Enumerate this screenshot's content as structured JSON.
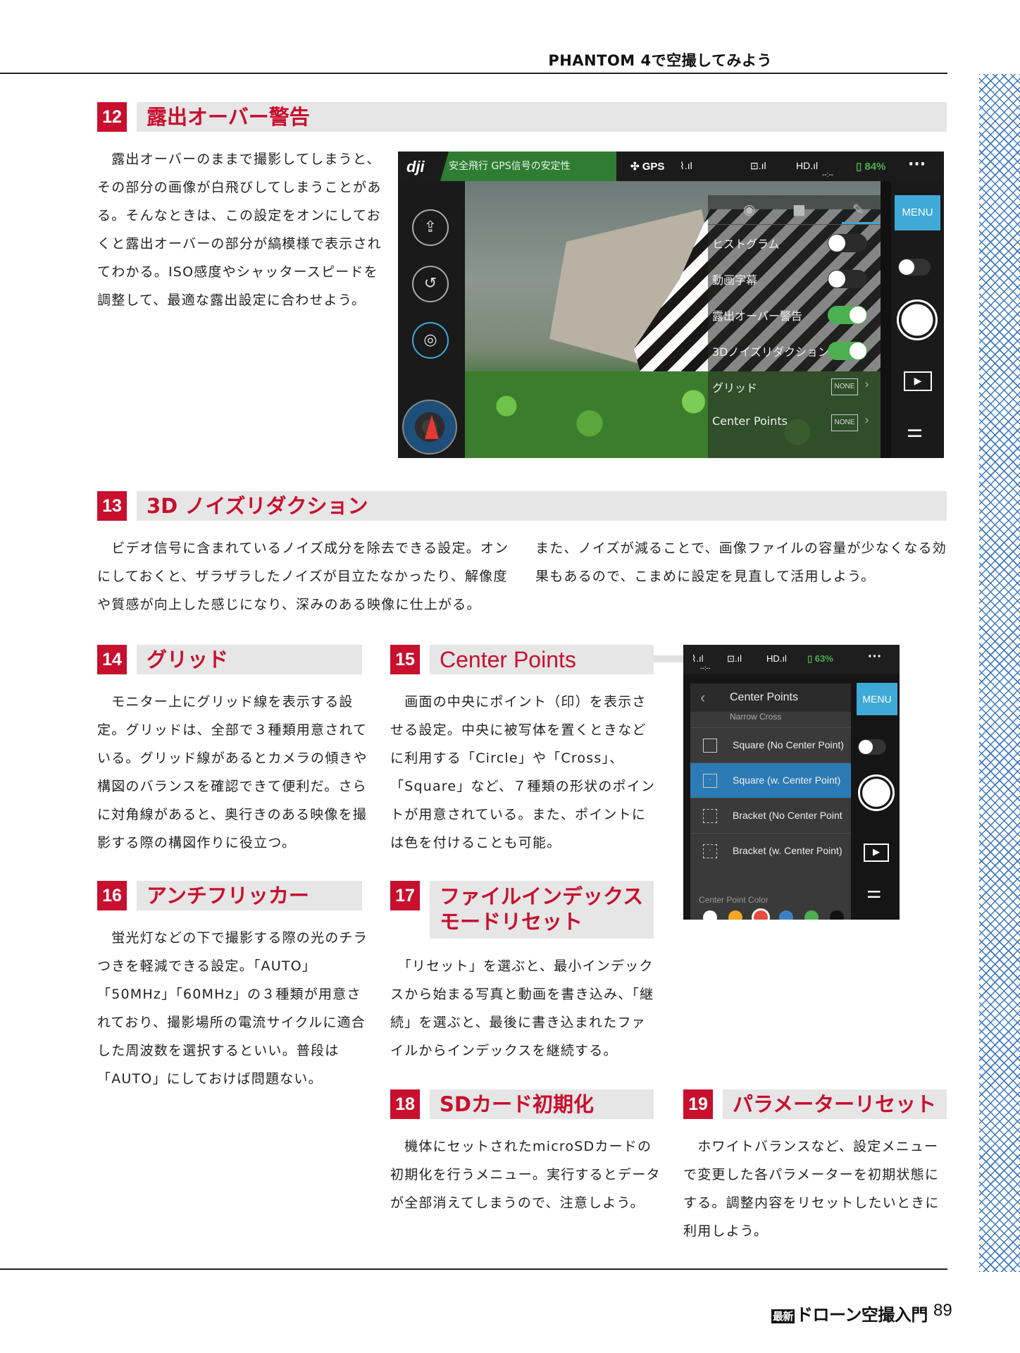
{
  "header": {
    "running_title": "PHANTOM 4で空撮してみよう"
  },
  "sections": [
    {
      "num": "12",
      "title": "露出オーバー警告",
      "body": "　露出オーバーのままで撮影してしまうと、その部分の画像が白飛びしてしまうことがある。そんなときは、この設定をオンにしておくと露出オーバーの部分が縞模様で表示されてわかる。ISO感度やシャッタースピードを調整して、最適な露出設定に合わせよう。"
    },
    {
      "num": "13",
      "title": "3D ノイズリダクション",
      "body_left": "　ビデオ信号に含まれているノイズ成分を除去できる設定。オンにしておくと、ザラザラしたノイズが目立たなかったり、解像度や質感が向上した感じになり、深みのある映像に仕上がる。",
      "body_right": "また、ノイズが減ることで、画像ファイルの容量が少なくなる効果もあるので、こまめに設定を見直して活用しよう。"
    },
    {
      "num": "14",
      "title": "グリッド",
      "body": "　モニター上にグリッド線を表示する設定。グリッドは、全部で３種類用意されている。グリッド線があるとカメラの傾きや構図のバランスを確認できて便利だ。さらに対角線があると、奥行きのある映像を撮影する際の構図作りに役立つ。"
    },
    {
      "num": "15",
      "title": "Center Points",
      "body": "　画面の中央にポイント（印）を表示させる設定。中央に被写体を置くときなどに利用する「Circle」や「Cross」、「Square」など、７種類の形状のポイントが用意されている。また、ポイントには色を付けることも可能。"
    },
    {
      "num": "16",
      "title": "アンチフリッカー",
      "body": "　蛍光灯などの下で撮影する際の光のチラつきを軽減できる設定。「AUTO」「50MHz」「60MHz」の３種類が用意されており、撮影場所の電流サイクルに適合した周波数を選択するといい。普段は「AUTO」にしておけば問題ない。"
    },
    {
      "num": "17",
      "title_line1": "ファイルインデックス",
      "title_line2": "モードリセット",
      "body": "　「リセット」を選ぶと、最小インデックスから始まる写真と動画を書き込み、「継続」を選ぶと、最後に書き込まれたファイルからインデックスを継続する。"
    },
    {
      "num": "18",
      "title": "SDカード初期化",
      "body": "　機体にセットされたmicroSDカードの初期化を行うメニュー。実行するとデータが全部消えてしまうので、注意しよう。"
    },
    {
      "num": "19",
      "title": "パラメーターリセット",
      "body": "　ホワイトバランスなど、設定メニューで変更した各パラメーターを初期状態にする。調整内容をリセットしたいときに利用しよう。"
    }
  ],
  "screenshot1": {
    "logo": "dji",
    "status_text": "安全飛行 GPS信号の安定性",
    "gps_label": "GPS",
    "hd_label": "HD.ıl",
    "battery": "84%",
    "timer": "--:--",
    "menu_label": "MENU",
    "rows": [
      {
        "label": "ヒストグラム",
        "type": "toggle",
        "on": false
      },
      {
        "label": "動画字幕",
        "type": "toggle",
        "on": false
      },
      {
        "label": "露出オーバー警告",
        "type": "toggle",
        "on": true
      },
      {
        "label": "3Dノイズリダクション",
        "type": "toggle",
        "on": true
      },
      {
        "label": "グリッド",
        "type": "value",
        "value": "NONE"
      },
      {
        "label": "Center Points",
        "type": "value",
        "value": "NONE"
      }
    ],
    "colors": {
      "menu": "#3fa9d8",
      "toggle_on": "#4caf50",
      "status_bar": "#2e7d32"
    }
  },
  "screenshot2": {
    "hd_label": "HD.ıl",
    "battery": "63%",
    "timer": "--:--",
    "menu_label": "MENU",
    "list_title": "Center Points",
    "cut_item": "Narrow Cross",
    "items": [
      {
        "label": "Square (No Center Point)",
        "selected": false,
        "icon": "square"
      },
      {
        "label": "Square (w. Center Point)",
        "selected": true,
        "icon": "square-dot"
      },
      {
        "label": "Bracket (No Center Point",
        "selected": false,
        "icon": "bracket"
      },
      {
        "label": "Bracket (w. Center Point)",
        "selected": false,
        "icon": "bracket-dot"
      }
    ],
    "color_label": "Center Point Color",
    "color_swatches": [
      "#ffffff",
      "#f5a623",
      "#e74c3c",
      "#3b82c4",
      "#4caf50",
      "#111111"
    ],
    "selected_color": 2
  },
  "footer": {
    "book_title_small": "最新",
    "book_title": "ドローン空撮入門",
    "page": "89"
  }
}
